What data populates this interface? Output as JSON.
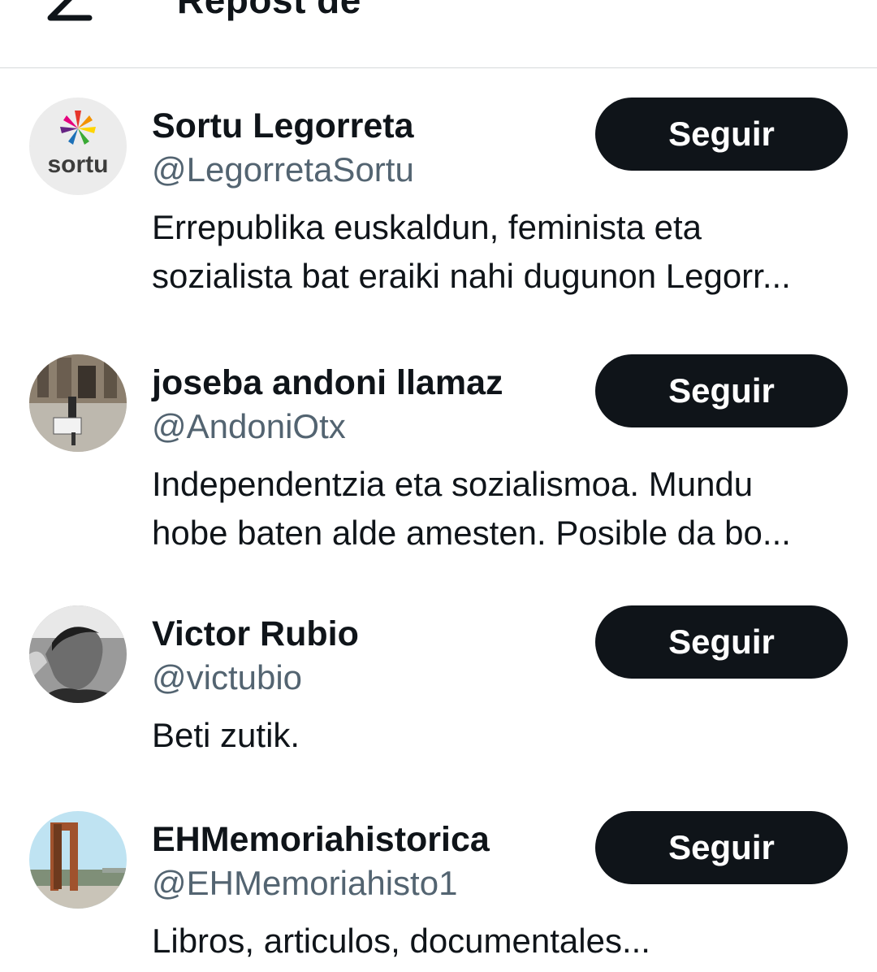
{
  "header": {
    "back_icon": "arrow-left-icon",
    "title": "Repost de"
  },
  "users": [
    {
      "avatar": "sortu-logo-avatar",
      "avatar_text": "sortu",
      "name": "Sortu Legorreta",
      "handle": "@LegorretaSortu",
      "bio_lines": [
        "Errepublika euskaldun, feminista eta",
        "sozialista bat eraiki nahi dugunon Legorr..."
      ],
      "follow_label": "Seguir"
    },
    {
      "avatar": "street-photo-avatar",
      "name": "joseba andoni llamaz",
      "handle": "@AndoniOtx",
      "bio_lines": [
        "Independentzia eta sozialismoa. Mundu",
        "hobe baten alde amesten. Posible da bo..."
      ],
      "follow_label": "Seguir"
    },
    {
      "avatar": "bw-portrait-avatar",
      "name": "Victor Rubio",
      "handle": "@victubio",
      "bio_lines": [
        "Beti zutik."
      ],
      "follow_label": "Seguir"
    },
    {
      "avatar": "monument-avatar",
      "name": "EHMemoriahistorica",
      "handle": "@EHMemoriahisto1",
      "bio_lines": [
        "Libros, articulos, documentales..."
      ],
      "follow_label": "Seguir"
    }
  ],
  "colors": {
    "text": "#0f1419",
    "secondary": "#536471",
    "button": "#0f1419",
    "divider": "#d6d9db"
  }
}
